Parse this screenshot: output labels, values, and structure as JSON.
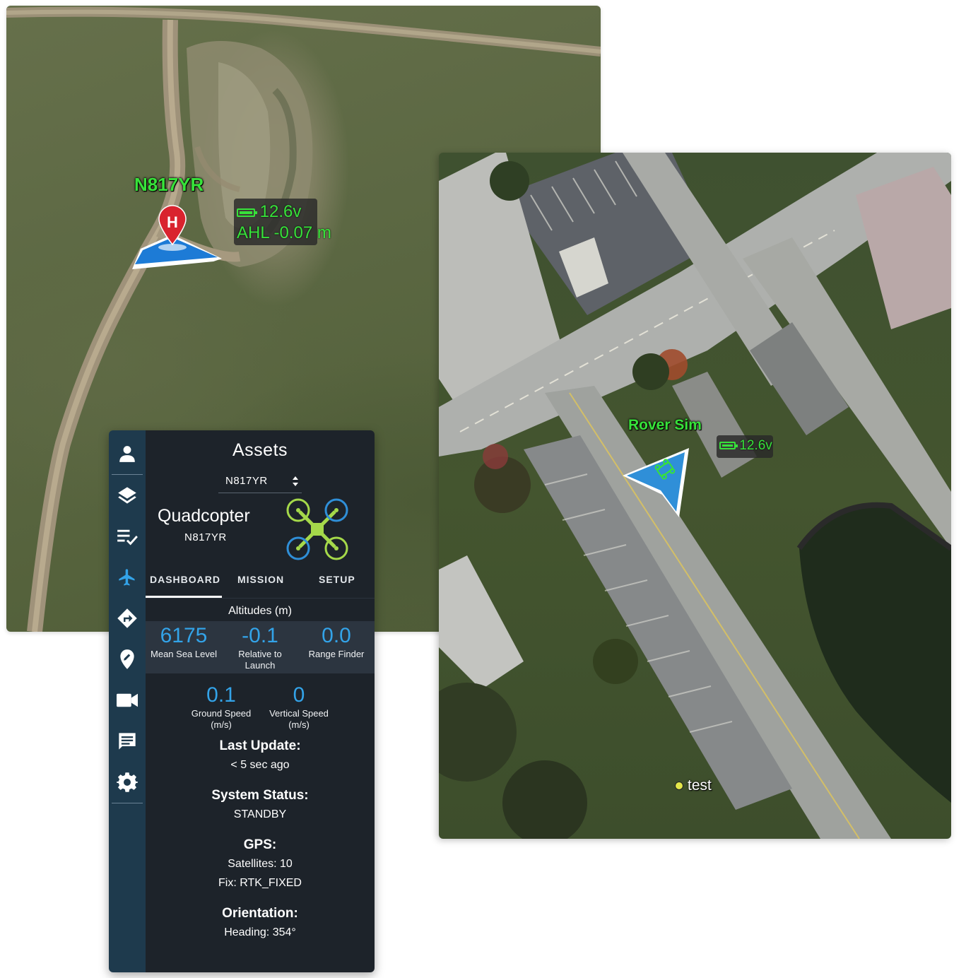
{
  "map_primary": {
    "vehicle": {
      "callsign": "N817YR",
      "home_marker": "H",
      "battery": "12.6v",
      "altitude_readout": "AHL -0.07 m"
    }
  },
  "map_secondary": {
    "vehicle": {
      "callsign": "Rover Sim",
      "battery": "12.6v"
    },
    "waypoint": {
      "label": "test"
    }
  },
  "panel": {
    "title": "Assets",
    "selector": {
      "selected": "N817YR"
    },
    "vehicle": {
      "type": "Quadcopter",
      "id": "N817YR"
    },
    "tabs": [
      "DASHBOARD",
      "MISSION",
      "SETUP"
    ],
    "active_tab": "DASHBOARD",
    "altitudes": {
      "heading": "Altitudes (m)",
      "mean_sea_level": {
        "value": "6175",
        "label": "Mean Sea Level"
      },
      "relative_to_launch": {
        "value": "-0.1",
        "label_line1": "Relative to",
        "label_line2": "Launch"
      },
      "range_finder": {
        "value": "0.0",
        "label": "Range Finder"
      }
    },
    "speeds": {
      "ground": {
        "value": "0.1",
        "label_line1": "Ground Speed",
        "label_line2": "(m/s)"
      },
      "vertical": {
        "value": "0",
        "label_line1": "Vertical Speed",
        "label_line2": "(m/s)"
      }
    },
    "last_update": {
      "heading": "Last Update:",
      "value": "< 5 sec ago"
    },
    "system_status": {
      "heading": "System Status:",
      "value": "STANDBY"
    },
    "gps": {
      "heading": "GPS:",
      "satellites": "Satellites: 10",
      "fix": "Fix: RTK_FIXED"
    },
    "orientation": {
      "heading": "Orientation:",
      "value": "Heading: 354°"
    }
  },
  "sidebar": {
    "icons": [
      "person-icon",
      "layers-icon",
      "playlist-check-icon",
      "airplane-icon",
      "directions-icon",
      "location-icon",
      "video-camera-icon",
      "chat-icon",
      "gear-icon"
    ],
    "active": "airplane-icon"
  },
  "colors": {
    "accent_blue": "#33a3e8",
    "label_green": "#37e23a",
    "rail_bg": "#1e3a4d",
    "panel_bg": "#1d232a",
    "home_marker_red": "#d9232e"
  }
}
